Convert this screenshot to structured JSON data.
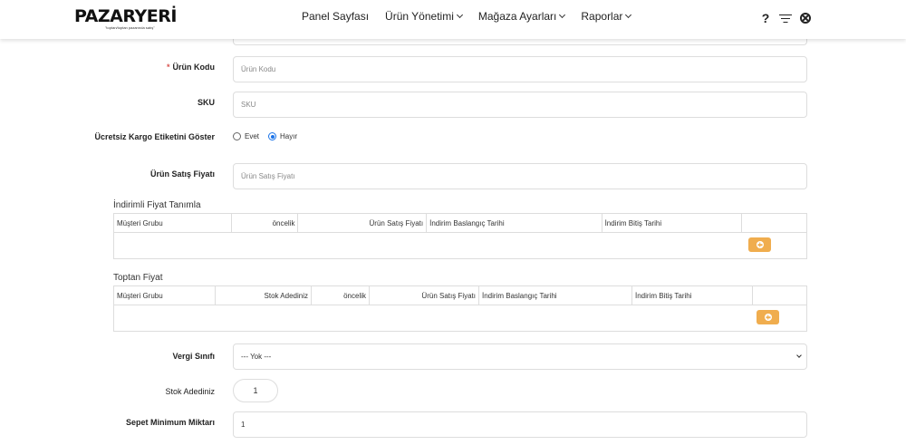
{
  "header": {
    "logo_text": "PAZARYERİ",
    "logo_tagline": "\"toptan/toptan pazarında satış\"",
    "nav": [
      {
        "label": "Panel Sayfası",
        "has_dropdown": false
      },
      {
        "label": "Ürün Yönetimi",
        "has_dropdown": true
      },
      {
        "label": "Mağaza Ayarları",
        "has_dropdown": true
      },
      {
        "label": "Raporlar",
        "has_dropdown": true
      }
    ],
    "tools": {
      "help": "?"
    }
  },
  "form": {
    "product_code": {
      "label": "Ürün Kodu",
      "required_mark": "*",
      "placeholder": "Ürün Kodu"
    },
    "sku": {
      "label": "SKU",
      "placeholder": "SKU"
    },
    "free_shipping": {
      "label": "Ücretsiz Kargo Etiketini Göster",
      "options": [
        "Evet",
        "Hayır"
      ],
      "selected": "Hayır"
    },
    "sale_price": {
      "label": "Ürün Satış Fiyatı",
      "placeholder": "Ürün Satış Fiyatı"
    },
    "tax_class": {
      "label": "Vergi Sınıfı",
      "value": "--- Yok ---"
    },
    "stock_count": {
      "label": "Stok Adediniz",
      "value": "1"
    },
    "cart_min": {
      "label": "Sepet Minimum Miktarı",
      "value": "1"
    }
  },
  "discount_table": {
    "title": "İndirimli Fiyat Tanımla",
    "columns": [
      "Müşteri Grubu",
      "öncelik",
      "Ürün Satış Fiyatı",
      "İndirim Baslangıç Tarihi",
      "İndirim Bitiş Tarihi"
    ]
  },
  "wholesale_table": {
    "title": "Toptan Fiyat",
    "columns": [
      "Müşteri Grubu",
      "Stok Adediniz",
      "öncelik",
      "Ürün Satış Fiyatı",
      "İndirim Baslangıç Tarihi",
      "İndirim Bitiş Tarihi"
    ]
  },
  "colors": {
    "accent": "#f0ad4e",
    "required": "#d9534f",
    "radio_checked": "#1a73e8"
  }
}
